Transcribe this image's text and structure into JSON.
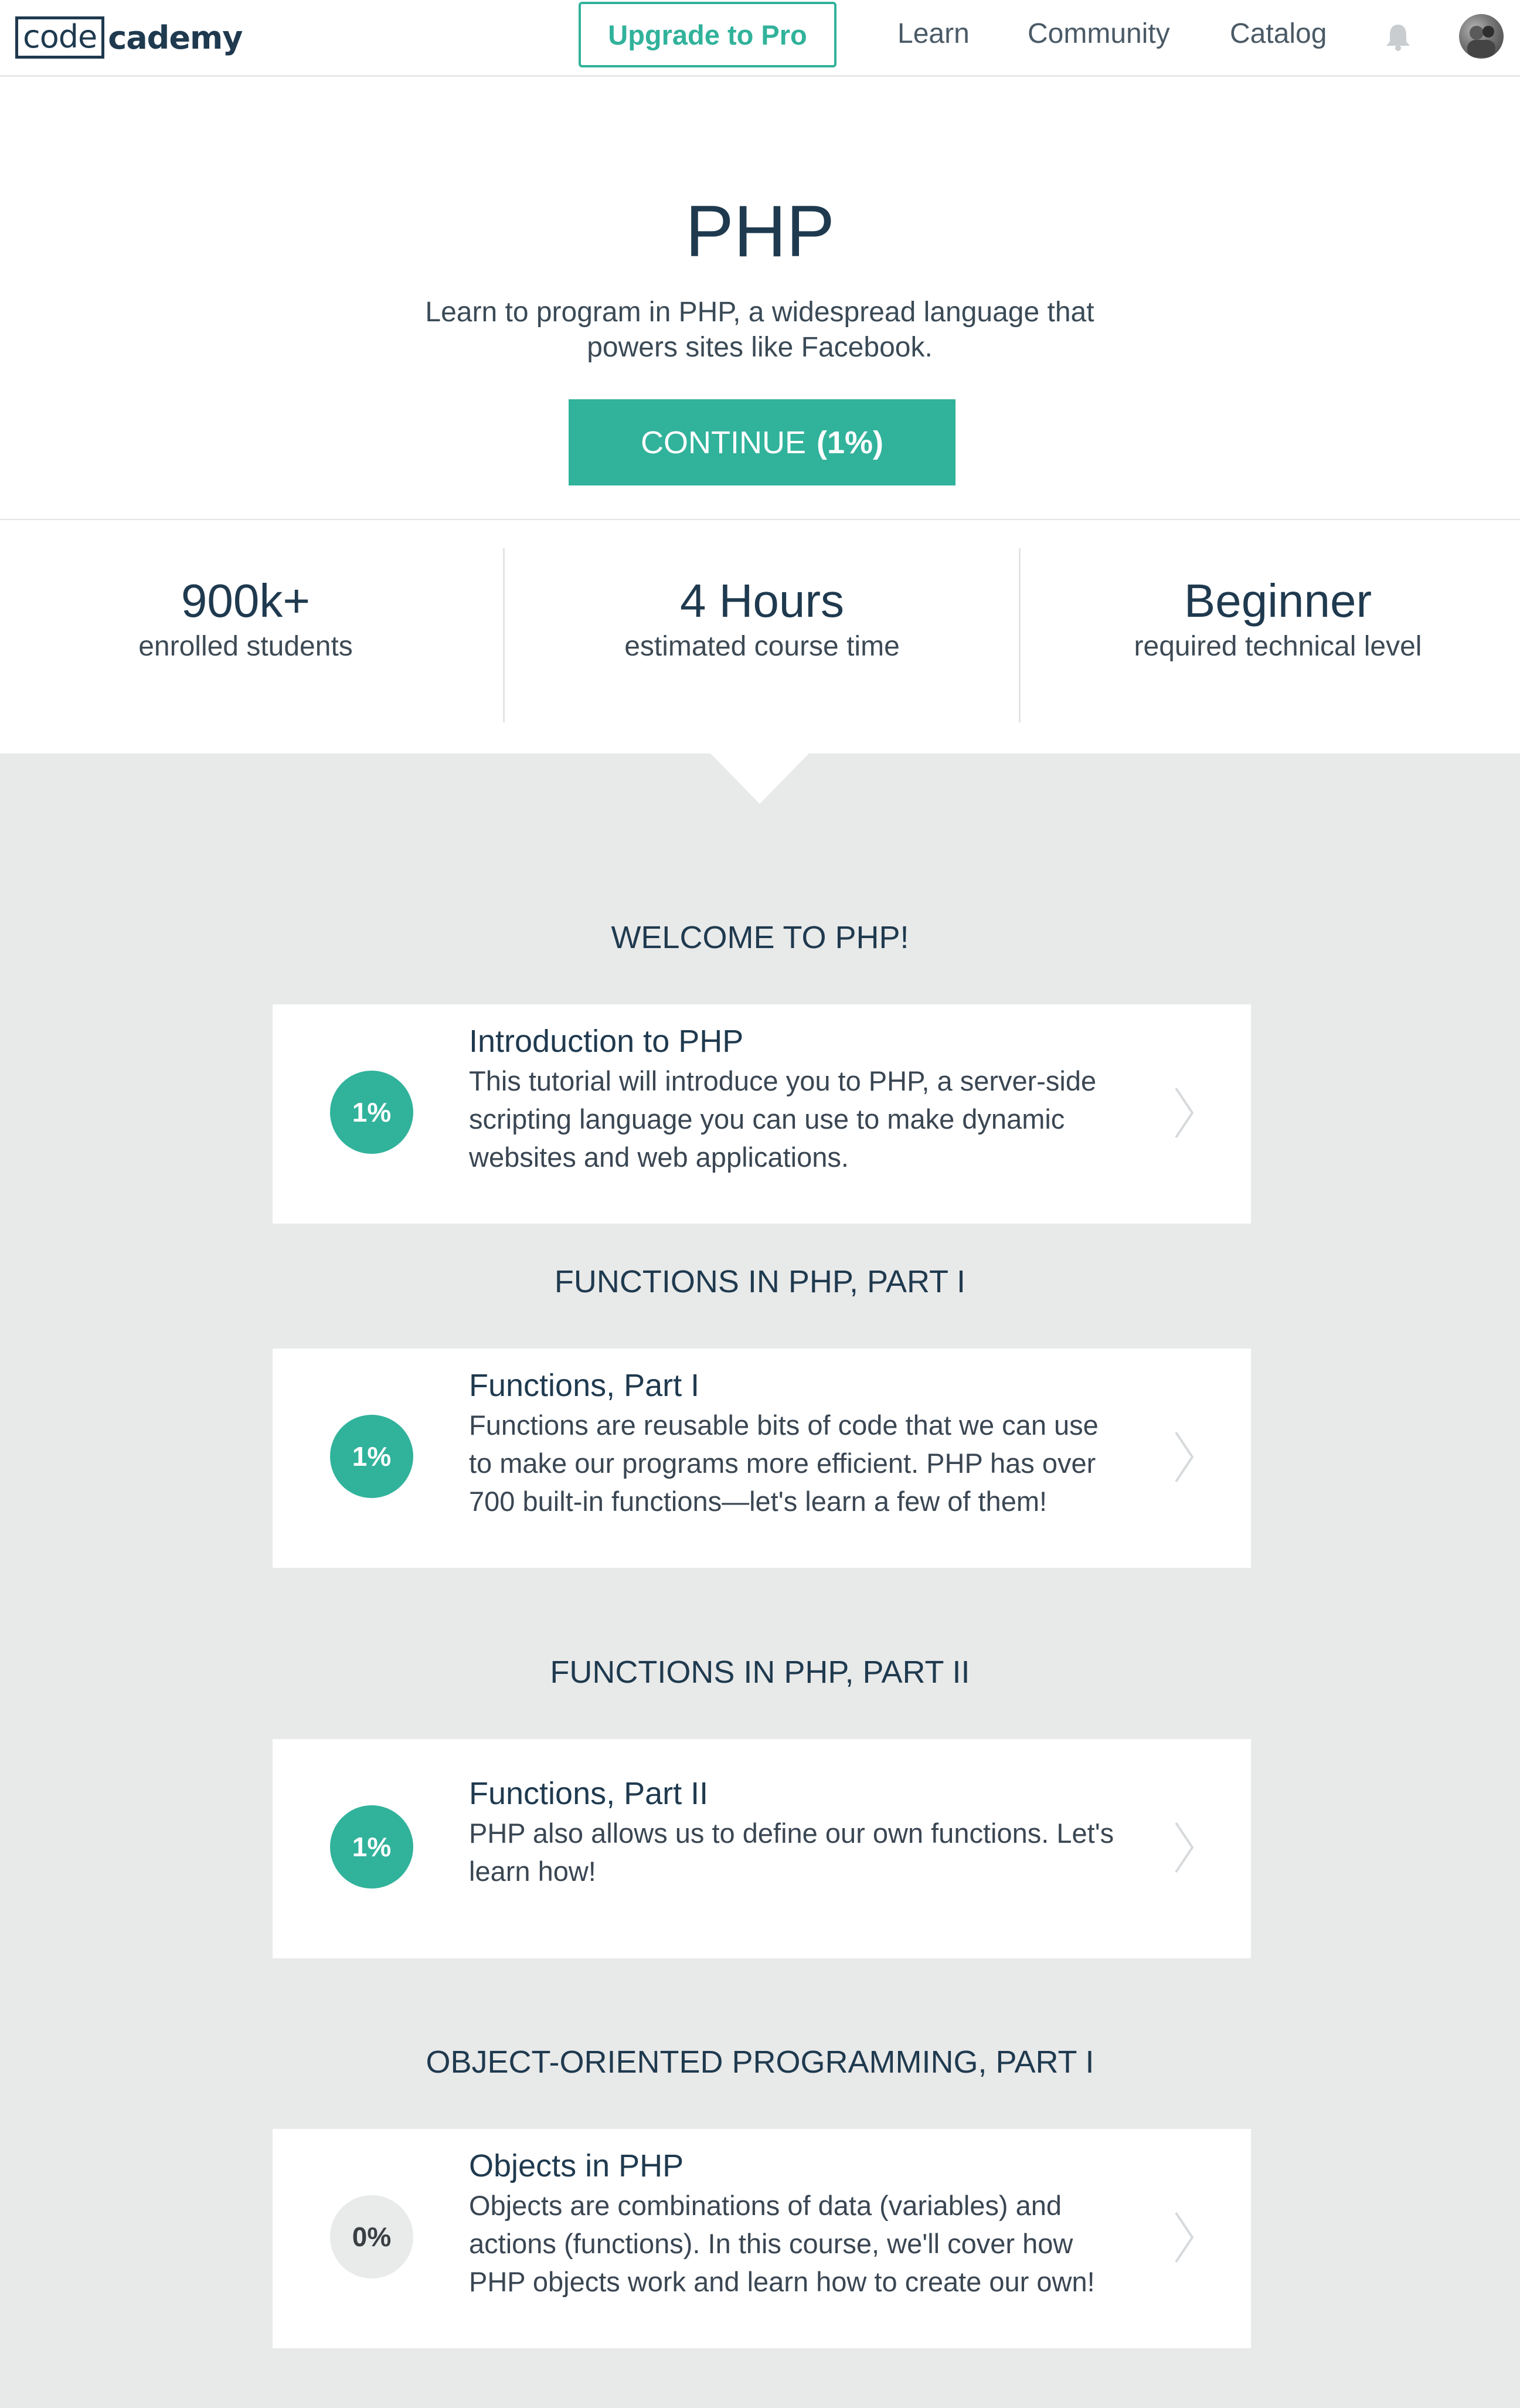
{
  "header": {
    "logo_code": "code",
    "logo_rest": "cademy",
    "upgrade_label": "Upgrade to Pro",
    "nav": [
      "Learn",
      "Community",
      "Catalog"
    ],
    "icons": [
      "bell-icon",
      "avatar"
    ]
  },
  "course": {
    "title": "PHP",
    "description": "Learn to program in PHP, a widespread language that powers sites like Facebook.",
    "continue_label": "CONTINUE",
    "continue_progress": "(1%)"
  },
  "stats": [
    {
      "value": "900k+",
      "label": "enrolled students"
    },
    {
      "value": "4 Hours",
      "label": "estimated course time"
    },
    {
      "value": "Beginner",
      "label": "required technical level"
    }
  ],
  "sections": [
    {
      "title": "WELCOME TO PHP!",
      "lesson": {
        "progress": "1%",
        "title": "Introduction to PHP",
        "description": "This tutorial will introduce you to PHP, a server-side scripting language you can use to make dynamic websites and web applications."
      }
    },
    {
      "title": "FUNCTIONS IN PHP, PART I",
      "lesson": {
        "progress": "1%",
        "title": "Functions, Part I",
        "description": "Functions are reusable bits of code that we can use to make our programs more efficient. PHP has over 700 built-in functions—let's learn a few of them!"
      }
    },
    {
      "title": "FUNCTIONS IN PHP, PART II",
      "lesson": {
        "progress": "1%",
        "title": "Functions, Part II",
        "description": "PHP also allows us to define our own functions. Let's learn how!"
      }
    },
    {
      "title": "OBJECT-ORIENTED PROGRAMMING, PART I",
      "lesson": {
        "progress": "0%",
        "title": "Objects in PHP",
        "description": "Objects are combinations of data (variables) and actions (functions). In this course, we'll cover how PHP objects work and learn how to create our own!"
      }
    }
  ],
  "colors": {
    "accent": "#31b29b",
    "navy": "#1f3a4f",
    "page_bg": "#e8e9e9"
  }
}
